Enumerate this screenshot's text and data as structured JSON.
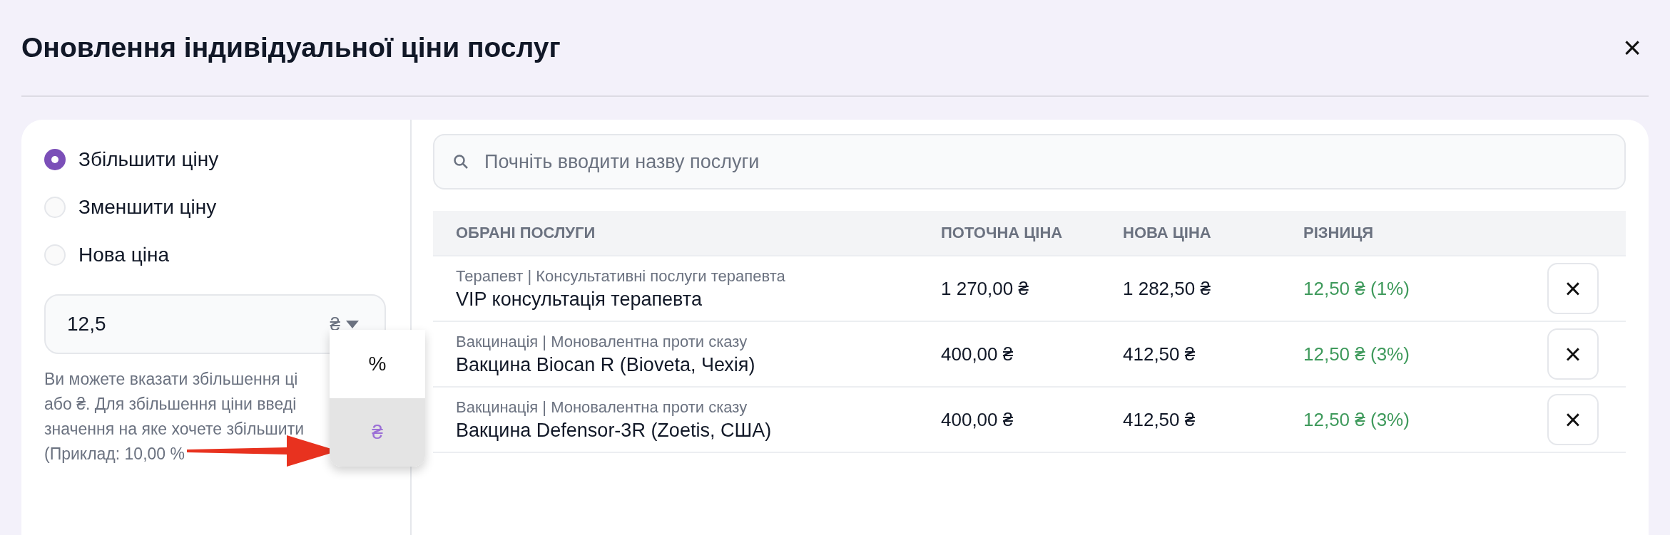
{
  "window": {
    "title": "Оновлення індивідуальної ціни послуг",
    "close": "×"
  },
  "modes": [
    {
      "label": "Збільшити ціну",
      "selected": true
    },
    {
      "label": "Зменшити ціну",
      "selected": false
    },
    {
      "label": "Нова ціна",
      "selected": false
    }
  ],
  "amount": {
    "value": "12,5",
    "unit": "₴"
  },
  "unit_menu": [
    {
      "label": "%",
      "selected": false
    },
    {
      "label": "₴",
      "selected": true
    }
  ],
  "help_lines": [
    "Ви можете вказати збільшення ці",
    "або ₴. Для збільшення ціни введі",
    "значення на яке хочете збільшити",
    "(Приклад: 10,00 %"
  ],
  "search": {
    "placeholder": "Почніть вводити назву послуги"
  },
  "table": {
    "columns": [
      "ОБРАНІ ПОСЛУГИ",
      "ПОТОЧНА ЦІНА",
      "НОВА ЦІНА",
      "РІЗНИЦЯ"
    ],
    "rows": [
      {
        "category": "Терапевт | Консультативні послуги терапевта",
        "name": "VIP консультація терапевта",
        "current": "1 270,00 ₴",
        "new": "1 282,50 ₴",
        "difference": "12,50 ₴ (1%)",
        "remove": "×"
      },
      {
        "category": "Вакцинація | Моновалентна проти сказу",
        "name": "Вакцина Biocan R (Bioveta, Чехія)",
        "current": "400,00 ₴",
        "new": "412,50 ₴",
        "difference": "12,50 ₴ (3%)",
        "remove": "×"
      },
      {
        "category": "Вакцинація | Моновалентна проти сказу",
        "name": "Вакцина Defensor-3R (Zoetis, США)",
        "current": "400,00 ₴",
        "new": "412,50 ₴",
        "difference": "12,50 ₴ (3%)",
        "remove": "×"
      }
    ]
  }
}
